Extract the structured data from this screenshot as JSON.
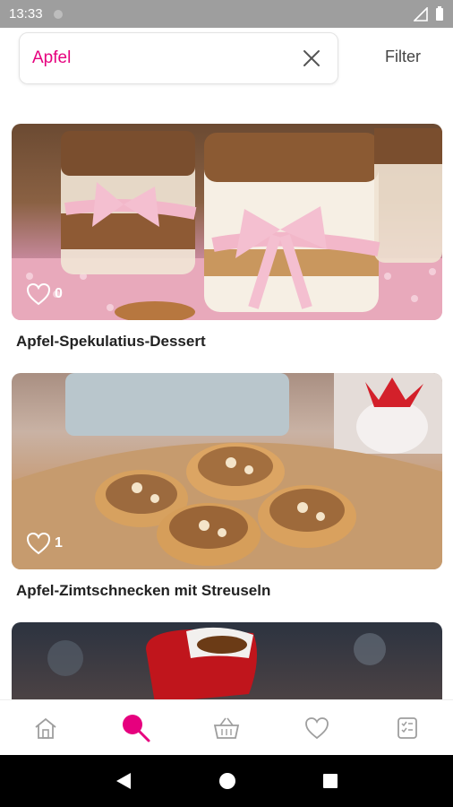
{
  "status_bar": {
    "time": "13:33"
  },
  "search": {
    "value": "Apfel",
    "filter_label": "Filter"
  },
  "recipes": [
    {
      "title": "Apfel-Spekulatius-Dessert",
      "likes": "0"
    },
    {
      "title": "Apfel-Zimtschnecken mit Streuseln",
      "likes": "1"
    },
    {
      "title": "",
      "likes": ""
    }
  ],
  "nav": {
    "items": [
      {
        "icon": "home-icon",
        "active": false
      },
      {
        "icon": "search-icon",
        "active": true
      },
      {
        "icon": "basket-icon",
        "active": false
      },
      {
        "icon": "heart-icon",
        "active": false
      },
      {
        "icon": "shopping-list-icon",
        "active": false
      }
    ],
    "accent_color": "#e6007e",
    "inactive_color": "#9e9e9e"
  }
}
